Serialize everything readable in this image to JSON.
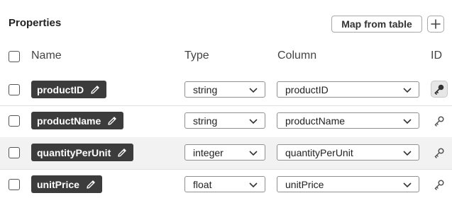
{
  "panel": {
    "title": "Properties",
    "map_button_label": "Map from table",
    "add_icon": "plus-icon"
  },
  "headers": {
    "name": "Name",
    "type": "Type",
    "column": "Column",
    "id": "ID"
  },
  "rows": [
    {
      "name": "productID",
      "type": "string",
      "column": "productID",
      "is_id": true
    },
    {
      "name": "productName",
      "type": "string",
      "column": "productName",
      "is_id": false
    },
    {
      "name": "quantityPerUnit",
      "type": "integer",
      "column": "quantityPerUnit",
      "is_id": false
    },
    {
      "name": "unitPrice",
      "type": "float",
      "column": "unitPrice",
      "is_id": false
    }
  ],
  "icons": {
    "edit": "pencil-icon",
    "dropdown": "chevron-down-icon",
    "id_key": "key-icon"
  },
  "colors": {
    "pill_background": "#3c3c3c",
    "pill_text": "#ffffff",
    "active_key_background": "#e6e6e6"
  }
}
